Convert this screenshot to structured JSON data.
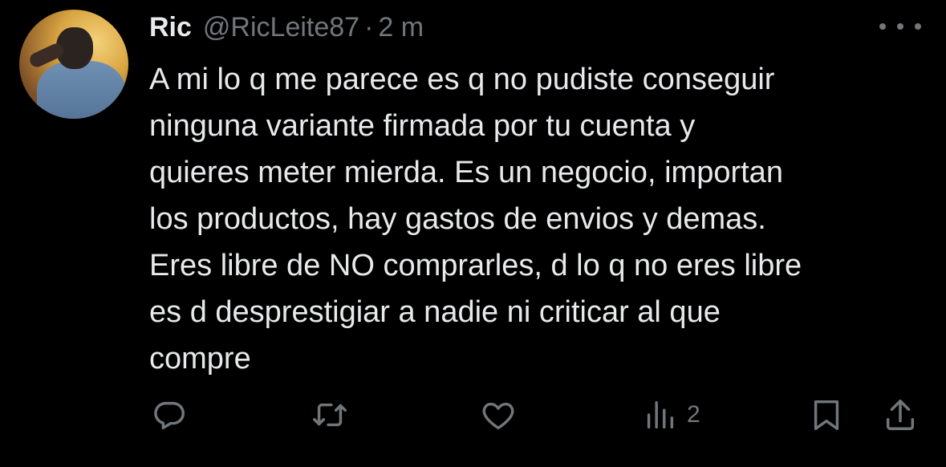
{
  "tweet": {
    "display_name": "Ric",
    "handle": "@RicLeite87",
    "separator": "·",
    "time": "2 m",
    "text_lines": [
      "A mi lo q me parece es q no pudiste conseguir",
      "ninguna variante firmada por tu cuenta y",
      "quieres meter mierda. Es un negocio, importan",
      "los productos, hay gastos de envios y demas.",
      "Eres libre de NO comprarles, d lo q no eres libre",
      "es d desprestigiar a nadie ni criticar al que",
      "compre"
    ]
  },
  "actions": {
    "reply_icon": "reply-icon",
    "retweet_icon": "retweet-icon",
    "like_icon": "heart-icon",
    "views_icon": "views-icon",
    "views_count": "2",
    "bookmark_icon": "bookmark-icon",
    "share_icon": "share-icon"
  },
  "colors": {
    "background": "#000000",
    "primary_text": "#e7e9ea",
    "secondary_text": "#71767b"
  }
}
